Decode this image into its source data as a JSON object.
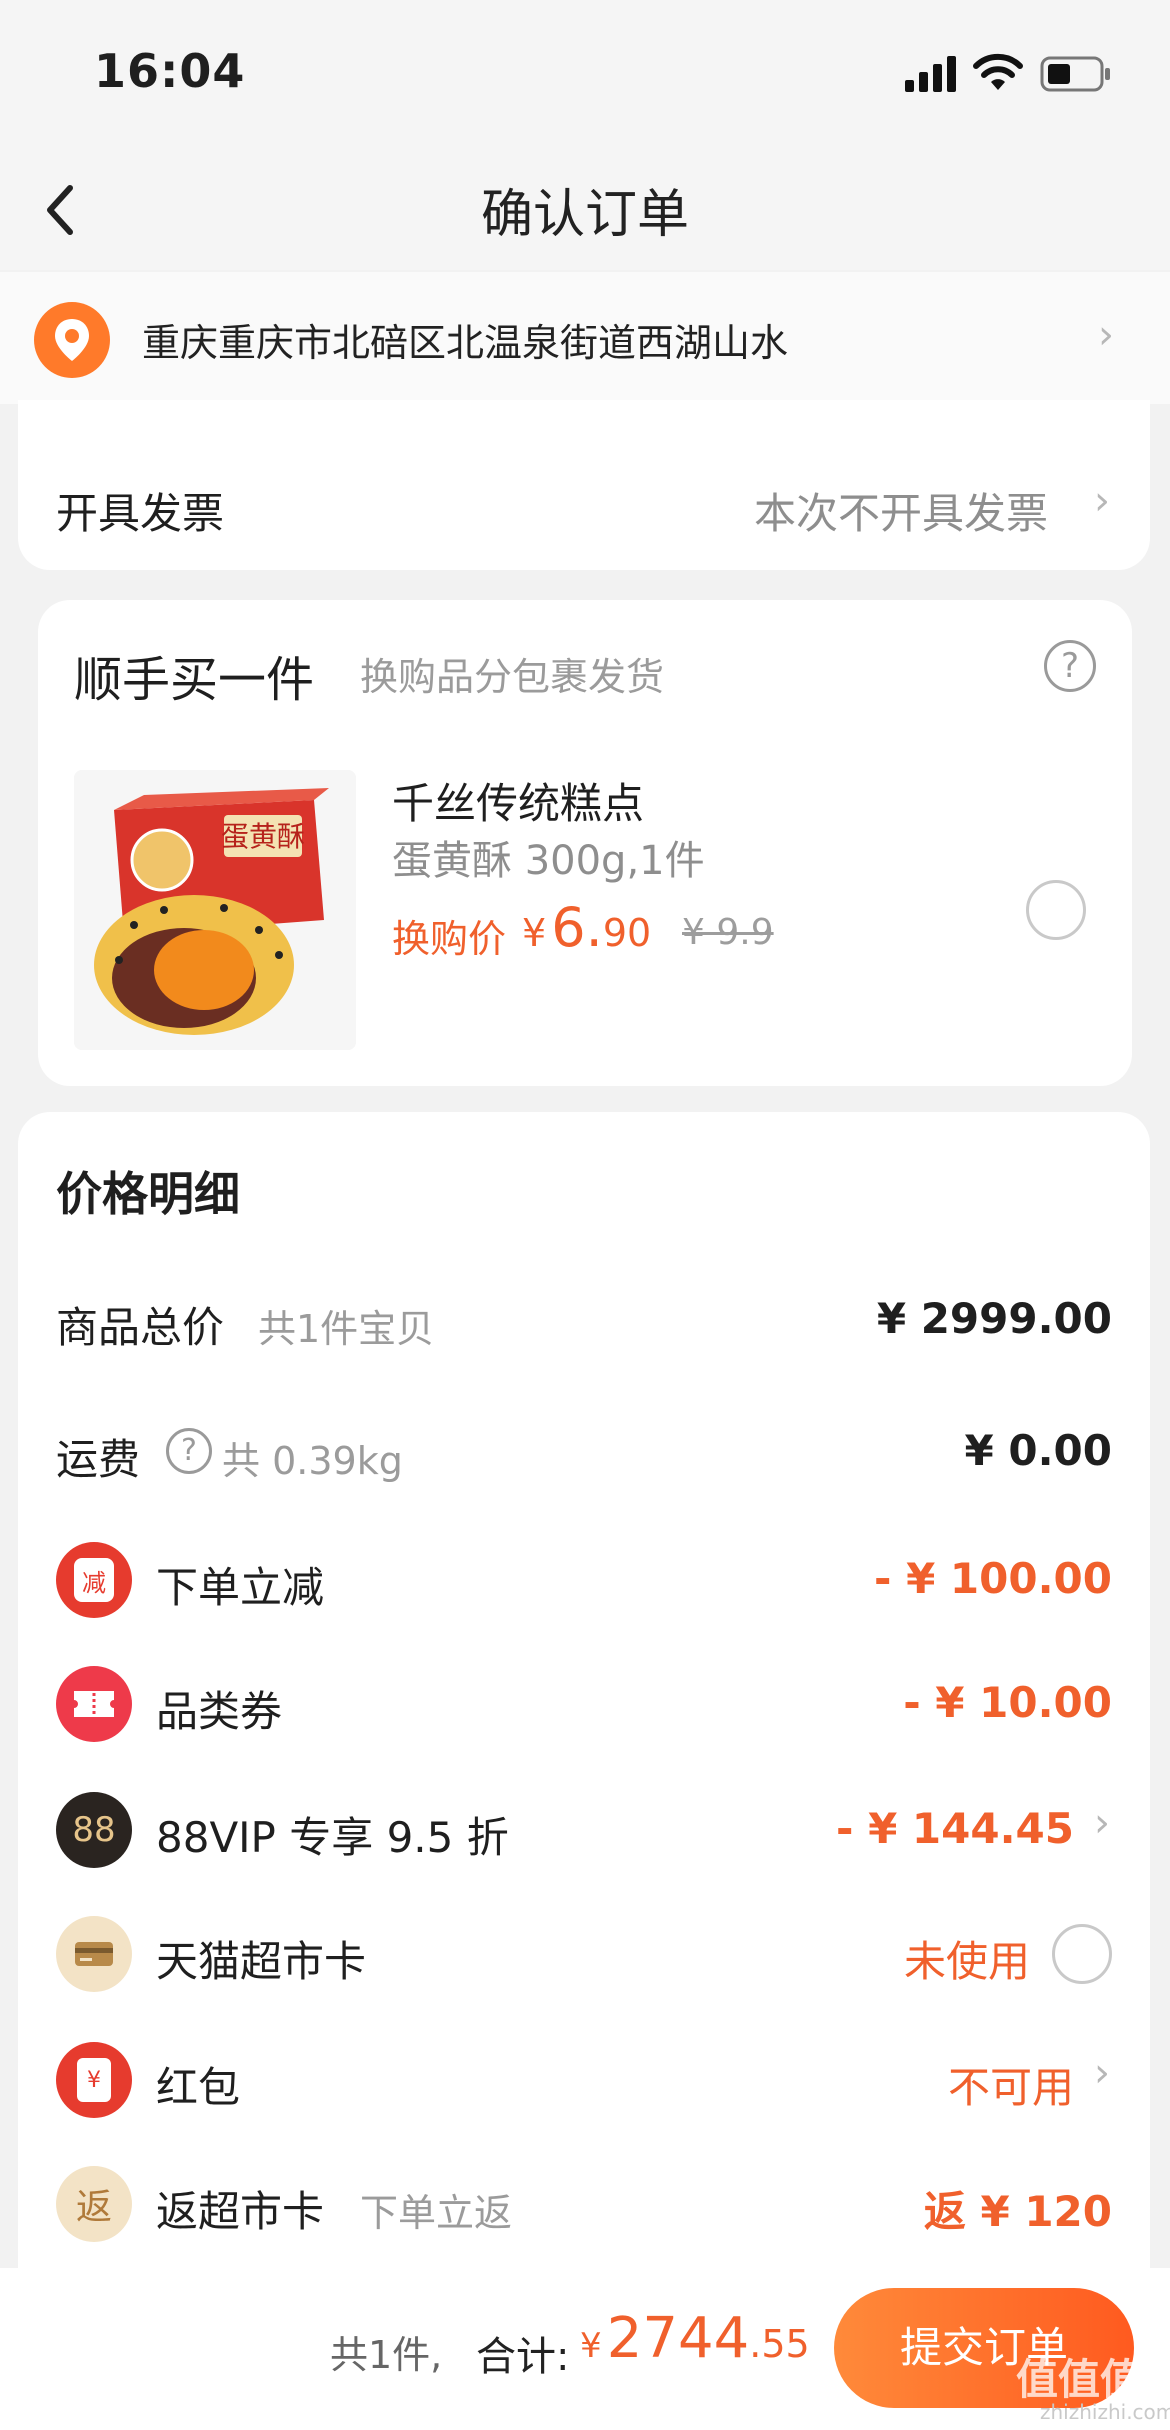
{
  "status_bar": {
    "time": "16:04"
  },
  "nav": {
    "title": "确认订单"
  },
  "address": {
    "text": "重庆重庆市北碚区北温泉街道西湖山水"
  },
  "invoice": {
    "label": "开具发票",
    "value": "本次不开具发票"
  },
  "addon": {
    "title": "顺手买一件",
    "subtitle": "换购品分包裹发货",
    "product": {
      "name": "千丝传统糕点",
      "spec": "蛋黄酥 300g,1件",
      "price_label": "换购价",
      "price_yen": "¥",
      "price_int": "6.",
      "price_dec": "90",
      "original_price": "¥ 9.9",
      "package_text": "蛋黄酥"
    }
  },
  "detail": {
    "title": "价格明细",
    "rows": [
      {
        "label": "商品总价",
        "sub": "共1件宝贝",
        "value": "¥ 2999.00"
      },
      {
        "label": "运费",
        "sub": "共 0.39kg",
        "value": "¥ 0.00"
      },
      {
        "label": "下单立减",
        "icon_text": "减",
        "value": "- ¥ 100.00"
      },
      {
        "label": "品类券",
        "value": "- ¥ 10.00"
      },
      {
        "label": "88VIP 专享 9.5 折",
        "icon_text": "88",
        "value": "- ¥ 144.45"
      },
      {
        "label": "天猫超市卡",
        "value": "未使用"
      },
      {
        "label": "红包",
        "icon_text": "¥",
        "value": "不可用"
      },
      {
        "label": "返超市卡",
        "sub": "下单立返",
        "icon_text": "返",
        "value": "返 ¥ 120"
      }
    ]
  },
  "bottom": {
    "count": "共1件,",
    "total_label": "合计:",
    "total_yen": "¥",
    "total_int": "2744",
    "total_dec": ".55",
    "submit_label": "提交订单",
    "watermark": "值值值",
    "watermark_sub": "zhizhizhi.com"
  },
  "colors": {
    "accent": "#f0602c",
    "background": "#f2f2f2"
  }
}
